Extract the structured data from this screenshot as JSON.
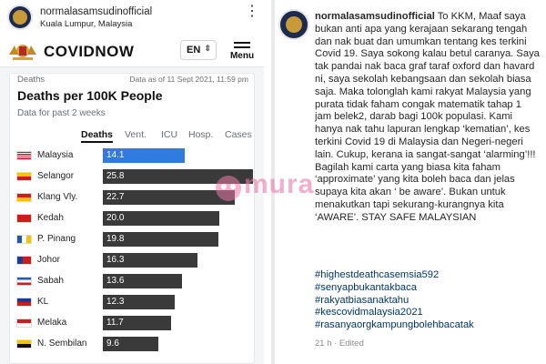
{
  "left_post": {
    "username": "normalasamsudinofficial",
    "location": "Kuala Lumpur, Malaysia",
    "more_icon": "kebab-icon"
  },
  "app": {
    "brand": "COVIDNOW",
    "language": "EN",
    "menu_label": "Menu",
    "card": {
      "section": "Deaths",
      "date_note": "Data as of 11 Sept 2021, 11:59 pm",
      "title": "Deaths per 100K People",
      "subtitle": "Data for past 2 weeks",
      "tabs": [
        {
          "label": "Deaths",
          "active": true
        },
        {
          "label": "Vent.",
          "active": false
        },
        {
          "label": "ICU",
          "active": false
        },
        {
          "label": "Hosp.",
          "active": false
        },
        {
          "label": "Cases",
          "active": false
        }
      ]
    }
  },
  "chart_data": {
    "type": "bar",
    "title": "Deaths per 100K People",
    "categories": [
      "Malaysia",
      "Selangor",
      "Klang Vly.",
      "Kedah",
      "P. Pinang",
      "Johor",
      "Sabah",
      "KL",
      "Melaka",
      "N. Sembilan"
    ],
    "values": [
      14.1,
      25.8,
      22.7,
      20.0,
      19.8,
      16.3,
      13.6,
      12.3,
      11.7,
      9.6
    ],
    "value_labels": [
      "14.1",
      "25.8",
      "22.7",
      "20.0",
      "19.8",
      "16.3",
      "13.6",
      "12.3",
      "11.7",
      "9.6"
    ],
    "highlight_index": 0,
    "colors": {
      "highlight": "#2f7be0",
      "default": "#3a3a3a"
    },
    "xlim": [
      0,
      25.8
    ]
  },
  "right_post": {
    "username": "normalasamsudinofficial",
    "caption": "To KKM, Maaf saya bukan anti apa yang kerajaan sekarang tengah dan nak buat dan umumkan tentang kes terkini Covid 19. Saya sokong kalau betul caranya. Saya tak pandai nak baca graf taraf oxford dan havard ni, saya sekolah kebangsaan dan sekolah biasa saja. Maka tolonglah kami rakyat Malaysia yang purata tidak faham congak matematik tahap 1 jam belek2, darab bagi 100k populasi. Kami hanya nak tahu lapuran lengkap ‘kematian’, kes terkini Covid 19 di Malaysia dan Negeri-negeri lain. Cukup, kerana ia sangat-sangat ‘alarming’!!! Bagilah kami carta yang biasa kita faham ‘approximate’ yang kita boleh baca dan jelas supaya kita akan ‘ be aware’. Bukan untuk menakutkan tapi sekurang-kurangnya kita ‘AWARE’. STAY SAFE MALAYSIAN",
    "hashtags": [
      "#highestdeathcasemsia592",
      "#senyapbukantakbaca",
      "#rakyatbiasanaktahu",
      "#kescovidmalaysia2021",
      "#rasanyaorgkampungbolehbacatak"
    ],
    "meta": "21 h · Edited"
  },
  "watermark": {
    "text": "mura",
    "color": "#e978aa"
  }
}
